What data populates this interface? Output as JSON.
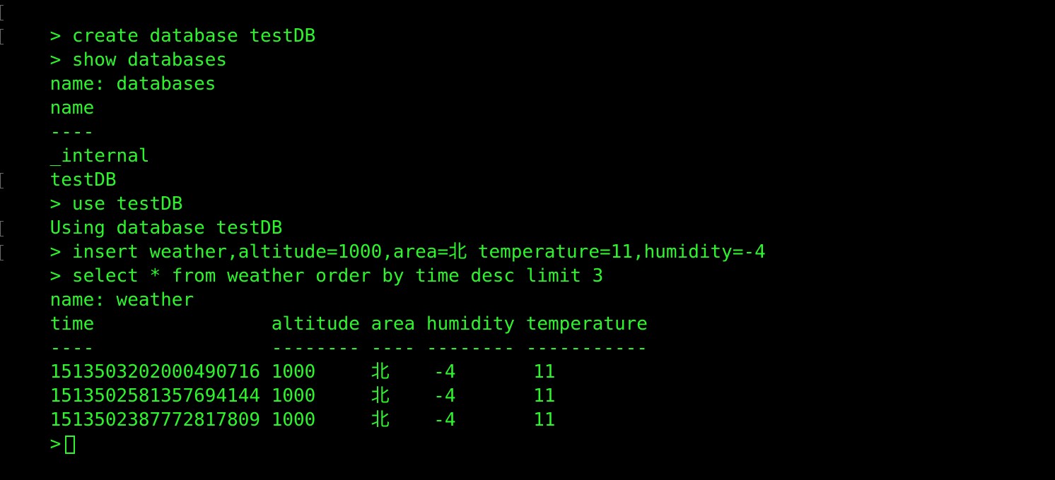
{
  "terminal": {
    "colors": {
      "background": "#000000",
      "text": "#2cf52c",
      "gutter": "#6a6a6a"
    },
    "lines": [
      "> create database testDB",
      "> show databases",
      "name: databases",
      "name",
      "----",
      "_internal",
      "testDB",
      "> use testDB",
      "Using database testDB",
      "> insert weather,altitude=1000,area=北 temperature=11,humidity=-4",
      "> select * from weather order by time desc limit 3",
      "name: weather",
      "time                altitude area humidity temperature",
      "----                -------- ---- -------- -----------",
      "1513503202000490716 1000     北    -4       11",
      "1513502581357694144 1000     北    -4       11",
      "1513502387772817809 1000     北    -4       11"
    ],
    "prompt": ">"
  }
}
